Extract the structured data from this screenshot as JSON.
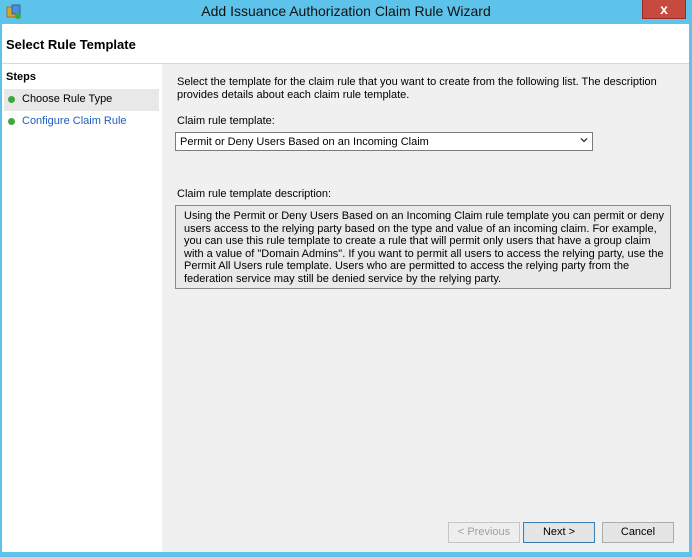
{
  "window": {
    "title": "Add Issuance Authorization Claim Rule Wizard",
    "close_label": "x"
  },
  "header": {
    "title": "Select Rule Template"
  },
  "steps": {
    "heading": "Steps",
    "items": [
      {
        "label": "Choose Rule Type",
        "state": "current",
        "status_color": "#3ea742"
      },
      {
        "label": "Configure Claim Rule",
        "state": "link",
        "status_color": "#3ea742",
        "link_color": "#1f5fbf"
      }
    ]
  },
  "main": {
    "intro": "Select the template for the claim rule that you want to create from the following list. The description provides details about each claim rule template.",
    "template_label": "Claim rule template:",
    "template_value": "Permit or Deny Users Based on an Incoming Claim",
    "description_label": "Claim rule template description:",
    "description_text": "Using the Permit or Deny Users Based on an Incoming Claim rule template you can permit or deny users access to the relying party based on the type and value of an incoming claim.  For example, you can use this rule template to create a rule that will permit only users that have a group claim with a value of \"Domain Admins\".  If you want to permit all users to access the relying party, use the Permit All Users rule template.  Users who are permitted to access the relying party from the federation service may still be denied service by the relying party."
  },
  "footer": {
    "previous_label": "< Previous",
    "next_label": "Next >",
    "cancel_label": "Cancel"
  },
  "colors": {
    "frame": "#5ec3ea",
    "close": "#c74a3f",
    "step_dot": "#3ea742",
    "link": "#1f5fbf"
  }
}
